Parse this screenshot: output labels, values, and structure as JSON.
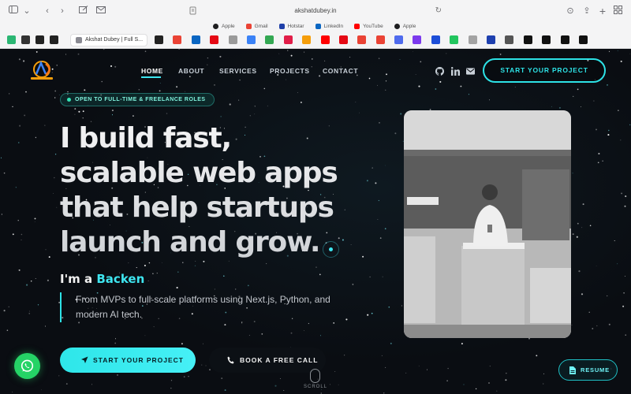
{
  "browser": {
    "url": "akshatdubey.in",
    "bookmarks": [
      {
        "label": "Apple",
        "icon": "apple-icon",
        "color": "#1d1d1f"
      },
      {
        "label": "Gmail",
        "icon": "gmail-icon",
        "color": "#ea4335"
      },
      {
        "label": "Hotstar",
        "icon": "hotstar-icon",
        "color": "#1f3fa8"
      },
      {
        "label": "LinkedIn",
        "icon": "linkedin-icon",
        "color": "#0a66c2"
      },
      {
        "label": "YouTube",
        "icon": "youtube-icon",
        "color": "#ff0000"
      },
      {
        "label": "Apple",
        "icon": "apple-icon",
        "color": "#1d1d1f"
      }
    ],
    "active_tab": "Akshat Dubey | Full S..."
  },
  "nav": {
    "items": [
      {
        "label": "HOME",
        "active": true
      },
      {
        "label": "ABOUT"
      },
      {
        "label": "SERVICES"
      },
      {
        "label": "PROJECTS"
      },
      {
        "label": "CONTACT"
      }
    ],
    "cta": "START YOUR PROJECT",
    "social_icons": [
      "github-icon",
      "linkedin-icon",
      "mail-icon"
    ]
  },
  "hero": {
    "badge": "OPEN TO FULL-TIME & FREELANCE ROLES",
    "headline": "I build fast, scalable web apps that help startups launch and grow.",
    "iam_prefix": "I'm a ",
    "role": "Backen",
    "description": "From MVPs to full-scale platforms using Next.js, Python, and modern AI tech.",
    "primary_button": "START YOUR PROJECT",
    "secondary_button": "BOOK A FREE CALL",
    "scroll_label": "SCROLL",
    "resume_button": "RESUME"
  },
  "colors": {
    "accent": "#2de2e6",
    "background": "#0a0d12",
    "badge_text": "#7ff3dd",
    "whatsapp": "#25d366"
  }
}
